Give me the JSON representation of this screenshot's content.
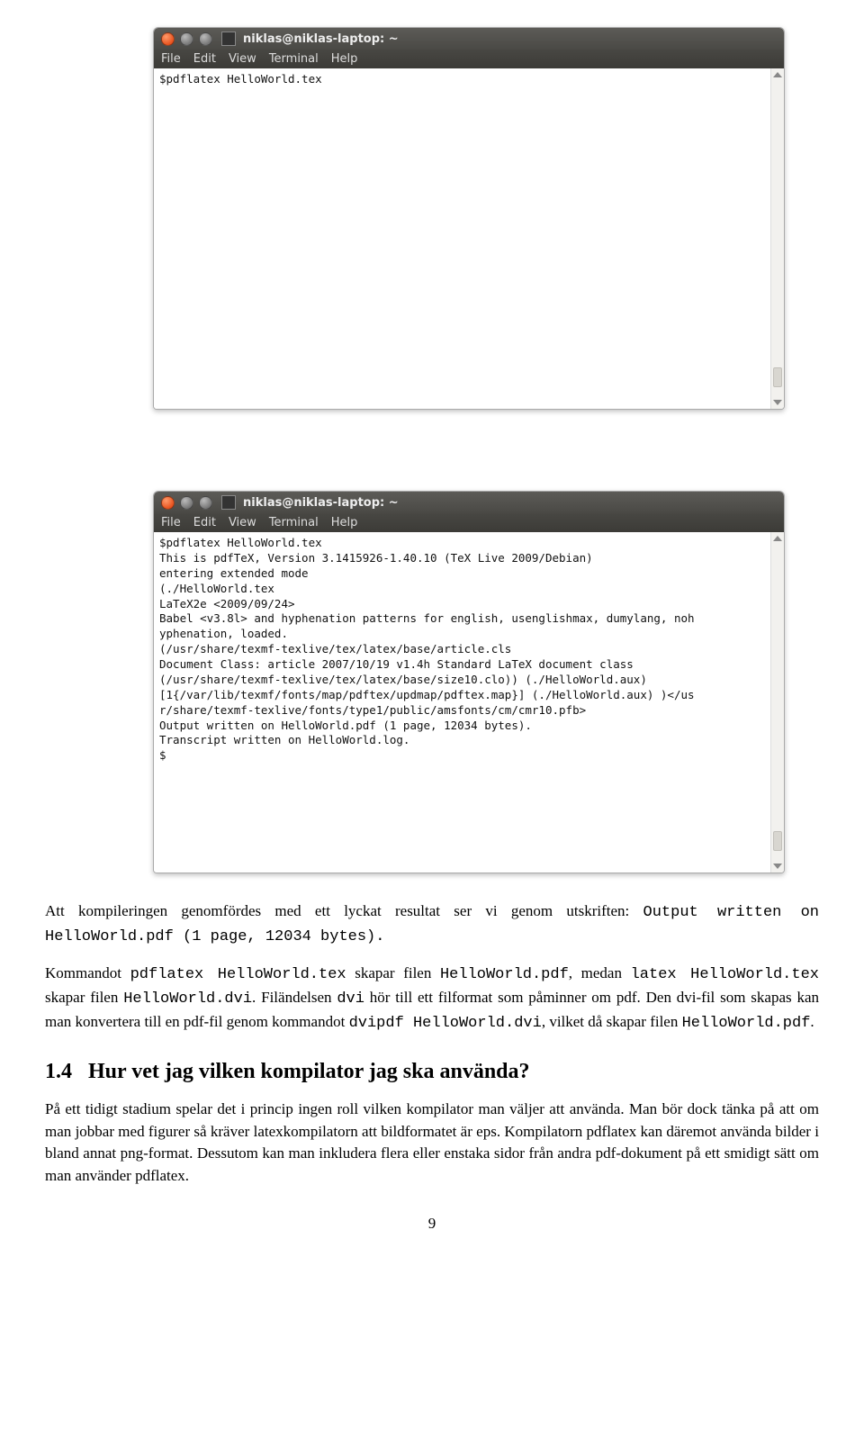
{
  "terminal1": {
    "title": "niklas@niklas-laptop: ~",
    "menu": {
      "file": "File",
      "edit": "Edit",
      "view": "View",
      "terminal": "Terminal",
      "help": "Help"
    },
    "content": "$pdflatex HelloWorld.tex"
  },
  "terminal2": {
    "title": "niklas@niklas-laptop: ~",
    "menu": {
      "file": "File",
      "edit": "Edit",
      "view": "View",
      "terminal": "Terminal",
      "help": "Help"
    },
    "content": "$pdflatex HelloWorld.tex\nThis is pdfTeX, Version 3.1415926-1.40.10 (TeX Live 2009/Debian)\nentering extended mode\n(./HelloWorld.tex\nLaTeX2e <2009/09/24>\nBabel <v3.8l> and hyphenation patterns for english, usenglishmax, dumylang, noh\nyphenation, loaded.\n(/usr/share/texmf-texlive/tex/latex/base/article.cls\nDocument Class: article 2007/10/19 v1.4h Standard LaTeX document class\n(/usr/share/texmf-texlive/tex/latex/base/size10.clo)) (./HelloWorld.aux)\n[1{/var/lib/texmf/fonts/map/pdftex/updmap/pdftex.map}] (./HelloWorld.aux) )</us\nr/share/texmf-texlive/fonts/type1/public/amsfonts/cm/cmr10.pfb>\nOutput written on HelloWorld.pdf (1 page, 12034 bytes).\nTranscript written on HelloWorld.log.\n$"
  },
  "body": {
    "p1a": "Att kompileringen genomfördes med ett lyckat resultat ser vi genom utskriften: ",
    "p1b": "Output written on HelloWorld.pdf (1 page, 12034 bytes).",
    "p2a": "Kommandot ",
    "p2b": "pdflatex HelloWorld.tex",
    "p2c": " skapar filen ",
    "p2d": "HelloWorld.pdf",
    "p2e": ", medan ",
    "p2f": "latex HelloWorld.tex",
    "p2g": " skapar filen ",
    "p2h": "HelloWorld.dvi",
    "p2i": ". Filändelsen ",
    "p2j": "dvi",
    "p2k": " hör till ett filformat som påminner om pdf. Den dvi-fil som skapas kan man konvertera till en pdf-fil genom kommandot ",
    "p2l": "dvipdf HelloWorld.dvi",
    "p2m": ", vilket då skapar filen ",
    "p2n": "HelloWorld.pdf",
    "p2o": "."
  },
  "section": {
    "num": "1.4",
    "title": "Hur vet jag vilken kompilator jag ska använda?"
  },
  "p3": "På ett tidigt stadium spelar det i princip ingen roll vilken kompilator man väljer att använda. Man bör dock tänka på att om man jobbar med figurer så kräver latexkompilatorn att bildformatet är eps. Kompilatorn pdflatex kan däremot använda bilder i bland annat png-format. Dessutom kan man inkludera flera eller enstaka sidor från andra pdf-dokument på ett smidigt sätt om man använder pdflatex.",
  "page_number": "9"
}
